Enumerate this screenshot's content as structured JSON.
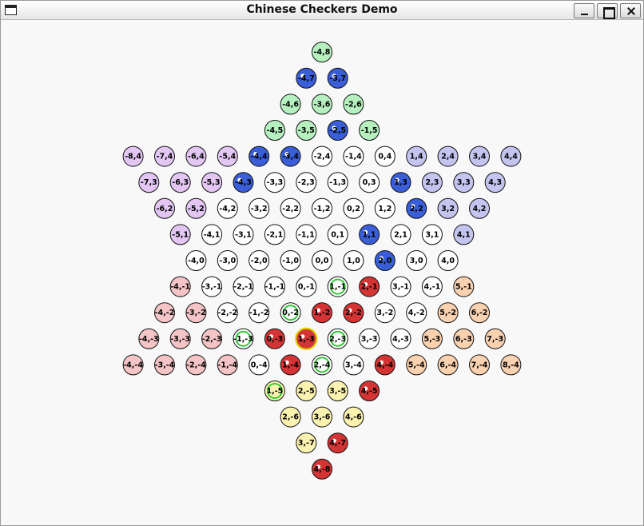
{
  "window": {
    "title": "Chinese Checkers Demo",
    "icon": "window-menu-icon",
    "controls": [
      "minimize-icon",
      "maximize-icon",
      "close-icon"
    ]
  },
  "colors": {
    "green": "#b6f0bf",
    "blue_piece": "#3a5ed8",
    "purple": "#e3c6f4",
    "lavender": "#c3c5f0",
    "empty": "#ffffff",
    "pink": "#f4c4c6",
    "orange": "#fbd2b0",
    "yellow": "#fbf2b0",
    "red_piece": "#d43434",
    "green_ring": "#22c72a",
    "selected_ring": "#e0d000"
  },
  "board": {
    "cells": [
      {
        "label": "-4,8",
        "fill": "green"
      },
      {
        "label": "-4,7",
        "fill": "blue_piece"
      },
      {
        "label": "-3,7",
        "fill": "blue_piece"
      },
      {
        "label": "-4,6",
        "fill": "green"
      },
      {
        "label": "-3,6",
        "fill": "green"
      },
      {
        "label": "-2,6",
        "fill": "green"
      },
      {
        "label": "-4,5",
        "fill": "green"
      },
      {
        "label": "-3,5",
        "fill": "green"
      },
      {
        "label": "-2,5",
        "fill": "blue_piece"
      },
      {
        "label": "-1,5",
        "fill": "green"
      },
      {
        "label": "-8,4",
        "fill": "purple"
      },
      {
        "label": "-7,4",
        "fill": "purple"
      },
      {
        "label": "-6,4",
        "fill": "purple"
      },
      {
        "label": "-5,4",
        "fill": "purple"
      },
      {
        "label": "-4,4",
        "fill": "blue_piece"
      },
      {
        "label": "-3,4",
        "fill": "blue_piece"
      },
      {
        "label": "-2,4",
        "fill": "empty"
      },
      {
        "label": "-1,4",
        "fill": "empty"
      },
      {
        "label": "0,4",
        "fill": "empty"
      },
      {
        "label": "1,4",
        "fill": "lavender"
      },
      {
        "label": "2,4",
        "fill": "lavender"
      },
      {
        "label": "3,4",
        "fill": "lavender"
      },
      {
        "label": "4,4",
        "fill": "lavender"
      },
      {
        "label": "-7,3",
        "fill": "purple"
      },
      {
        "label": "-6,3",
        "fill": "purple"
      },
      {
        "label": "-5,3",
        "fill": "purple"
      },
      {
        "label": "-4,3",
        "fill": "blue_piece"
      },
      {
        "label": "-3,3",
        "fill": "empty"
      },
      {
        "label": "-2,3",
        "fill": "empty"
      },
      {
        "label": "-1,3",
        "fill": "empty"
      },
      {
        "label": "0,3",
        "fill": "empty"
      },
      {
        "label": "1,3",
        "fill": "blue_piece"
      },
      {
        "label": "2,3",
        "fill": "lavender"
      },
      {
        "label": "3,3",
        "fill": "lavender"
      },
      {
        "label": "4,3",
        "fill": "lavender"
      },
      {
        "label": "-6,2",
        "fill": "purple"
      },
      {
        "label": "-5,2",
        "fill": "purple"
      },
      {
        "label": "-4,2",
        "fill": "empty"
      },
      {
        "label": "-3,2",
        "fill": "empty"
      },
      {
        "label": "-2,2",
        "fill": "empty"
      },
      {
        "label": "-1,2",
        "fill": "empty"
      },
      {
        "label": "0,2",
        "fill": "empty"
      },
      {
        "label": "1,2",
        "fill": "empty"
      },
      {
        "label": "2,2",
        "fill": "blue_piece"
      },
      {
        "label": "3,2",
        "fill": "lavender"
      },
      {
        "label": "4,2",
        "fill": "lavender"
      },
      {
        "label": "-5,1",
        "fill": "purple"
      },
      {
        "label": "-4,1",
        "fill": "empty"
      },
      {
        "label": "-3,1",
        "fill": "empty"
      },
      {
        "label": "-2,1",
        "fill": "empty"
      },
      {
        "label": "-1,1",
        "fill": "empty"
      },
      {
        "label": "0,1",
        "fill": "empty"
      },
      {
        "label": "1,1",
        "fill": "blue_piece"
      },
      {
        "label": "2,1",
        "fill": "empty"
      },
      {
        "label": "3,1",
        "fill": "empty"
      },
      {
        "label": "4,1",
        "fill": "lavender"
      },
      {
        "label": "-4,0",
        "fill": "empty"
      },
      {
        "label": "-3,0",
        "fill": "empty"
      },
      {
        "label": "-2,0",
        "fill": "empty"
      },
      {
        "label": "-1,0",
        "fill": "empty"
      },
      {
        "label": "0,0",
        "fill": "empty"
      },
      {
        "label": "1,0",
        "fill": "empty"
      },
      {
        "label": "2,0",
        "fill": "blue_piece"
      },
      {
        "label": "3,0",
        "fill": "empty"
      },
      {
        "label": "4,0",
        "fill": "empty"
      },
      {
        "label": "-4,-1",
        "fill": "pink"
      },
      {
        "label": "-3,-1",
        "fill": "empty"
      },
      {
        "label": "-2,-1",
        "fill": "empty"
      },
      {
        "label": "-1,-1",
        "fill": "empty"
      },
      {
        "label": "0,-1",
        "fill": "empty"
      },
      {
        "label": "1,-1",
        "fill": "empty",
        "ring": "green_ring"
      },
      {
        "label": "2,-1",
        "fill": "red_piece"
      },
      {
        "label": "3,-1",
        "fill": "empty"
      },
      {
        "label": "4,-1",
        "fill": "empty"
      },
      {
        "label": "5,-1",
        "fill": "orange"
      },
      {
        "label": "-4,-2",
        "fill": "pink"
      },
      {
        "label": "-3,-2",
        "fill": "pink"
      },
      {
        "label": "-2,-2",
        "fill": "empty"
      },
      {
        "label": "-1,-2",
        "fill": "empty"
      },
      {
        "label": "0,-2",
        "fill": "empty",
        "ring": "green_ring"
      },
      {
        "label": "1,-2",
        "fill": "red_piece"
      },
      {
        "label": "2,-2",
        "fill": "red_piece"
      },
      {
        "label": "3,-2",
        "fill": "empty"
      },
      {
        "label": "4,-2",
        "fill": "empty"
      },
      {
        "label": "5,-2",
        "fill": "orange"
      },
      {
        "label": "6,-2",
        "fill": "orange"
      },
      {
        "label": "-4,-3",
        "fill": "pink"
      },
      {
        "label": "-3,-3",
        "fill": "pink"
      },
      {
        "label": "-2,-3",
        "fill": "pink"
      },
      {
        "label": "-1,-3",
        "fill": "empty",
        "ring": "green_ring"
      },
      {
        "label": "0,-3",
        "fill": "red_piece"
      },
      {
        "label": "1,-3",
        "fill": "red_piece",
        "ring": "selected_ring"
      },
      {
        "label": "2,-3",
        "fill": "empty",
        "ring": "green_ring"
      },
      {
        "label": "3,-3",
        "fill": "empty"
      },
      {
        "label": "4,-3",
        "fill": "empty"
      },
      {
        "label": "5,-3",
        "fill": "orange"
      },
      {
        "label": "6,-3",
        "fill": "orange"
      },
      {
        "label": "7,-3",
        "fill": "orange"
      },
      {
        "label": "-4,-4",
        "fill": "pink"
      },
      {
        "label": "-3,-4",
        "fill": "pink"
      },
      {
        "label": "-2,-4",
        "fill": "pink"
      },
      {
        "label": "-1,-4",
        "fill": "pink"
      },
      {
        "label": "0,-4",
        "fill": "empty"
      },
      {
        "label": "1,-4",
        "fill": "red_piece"
      },
      {
        "label": "2,-4",
        "fill": "empty",
        "ring": "green_ring"
      },
      {
        "label": "3,-4",
        "fill": "empty"
      },
      {
        "label": "4,-4",
        "fill": "red_piece"
      },
      {
        "label": "5,-4",
        "fill": "orange"
      },
      {
        "label": "6,-4",
        "fill": "orange"
      },
      {
        "label": "7,-4",
        "fill": "orange"
      },
      {
        "label": "8,-4",
        "fill": "orange"
      },
      {
        "label": "1,-5",
        "fill": "yellow",
        "ring": "green_ring"
      },
      {
        "label": "2,-5",
        "fill": "yellow"
      },
      {
        "label": "3,-5",
        "fill": "yellow"
      },
      {
        "label": "4,-5",
        "fill": "red_piece"
      },
      {
        "label": "2,-6",
        "fill": "yellow"
      },
      {
        "label": "3,-6",
        "fill": "yellow"
      },
      {
        "label": "4,-6",
        "fill": "yellow"
      },
      {
        "label": "3,-7",
        "fill": "yellow"
      },
      {
        "label": "4,-7",
        "fill": "red_piece"
      },
      {
        "label": "4,-8",
        "fill": "red_piece"
      }
    ]
  }
}
